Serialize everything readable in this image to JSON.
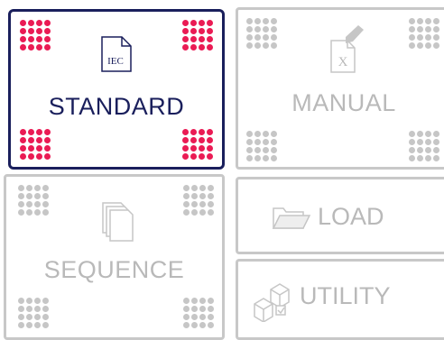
{
  "tiles": {
    "standard": {
      "label": "STANDARD",
      "icon": "iec-document-icon",
      "icon_text": "IEC",
      "state": "selected"
    },
    "manual": {
      "label": "MANUAL",
      "icon": "manual-edit-document-icon",
      "icon_text": "X",
      "state": "disabled"
    },
    "sequence": {
      "label": "SEQUENCE",
      "icon": "stacked-pages-icon",
      "state": "disabled"
    },
    "load": {
      "label": "LOAD",
      "icon": "open-folder-icon",
      "state": "disabled"
    },
    "utility": {
      "label": "UTILITY",
      "icon": "utility-blocks-icon",
      "state": "disabled"
    }
  },
  "colors": {
    "active_border": "#1a1f5c",
    "active_dots": "#ea1b54",
    "disabled": "#c6c6c6",
    "disabled_text": "#b9b9b9"
  }
}
